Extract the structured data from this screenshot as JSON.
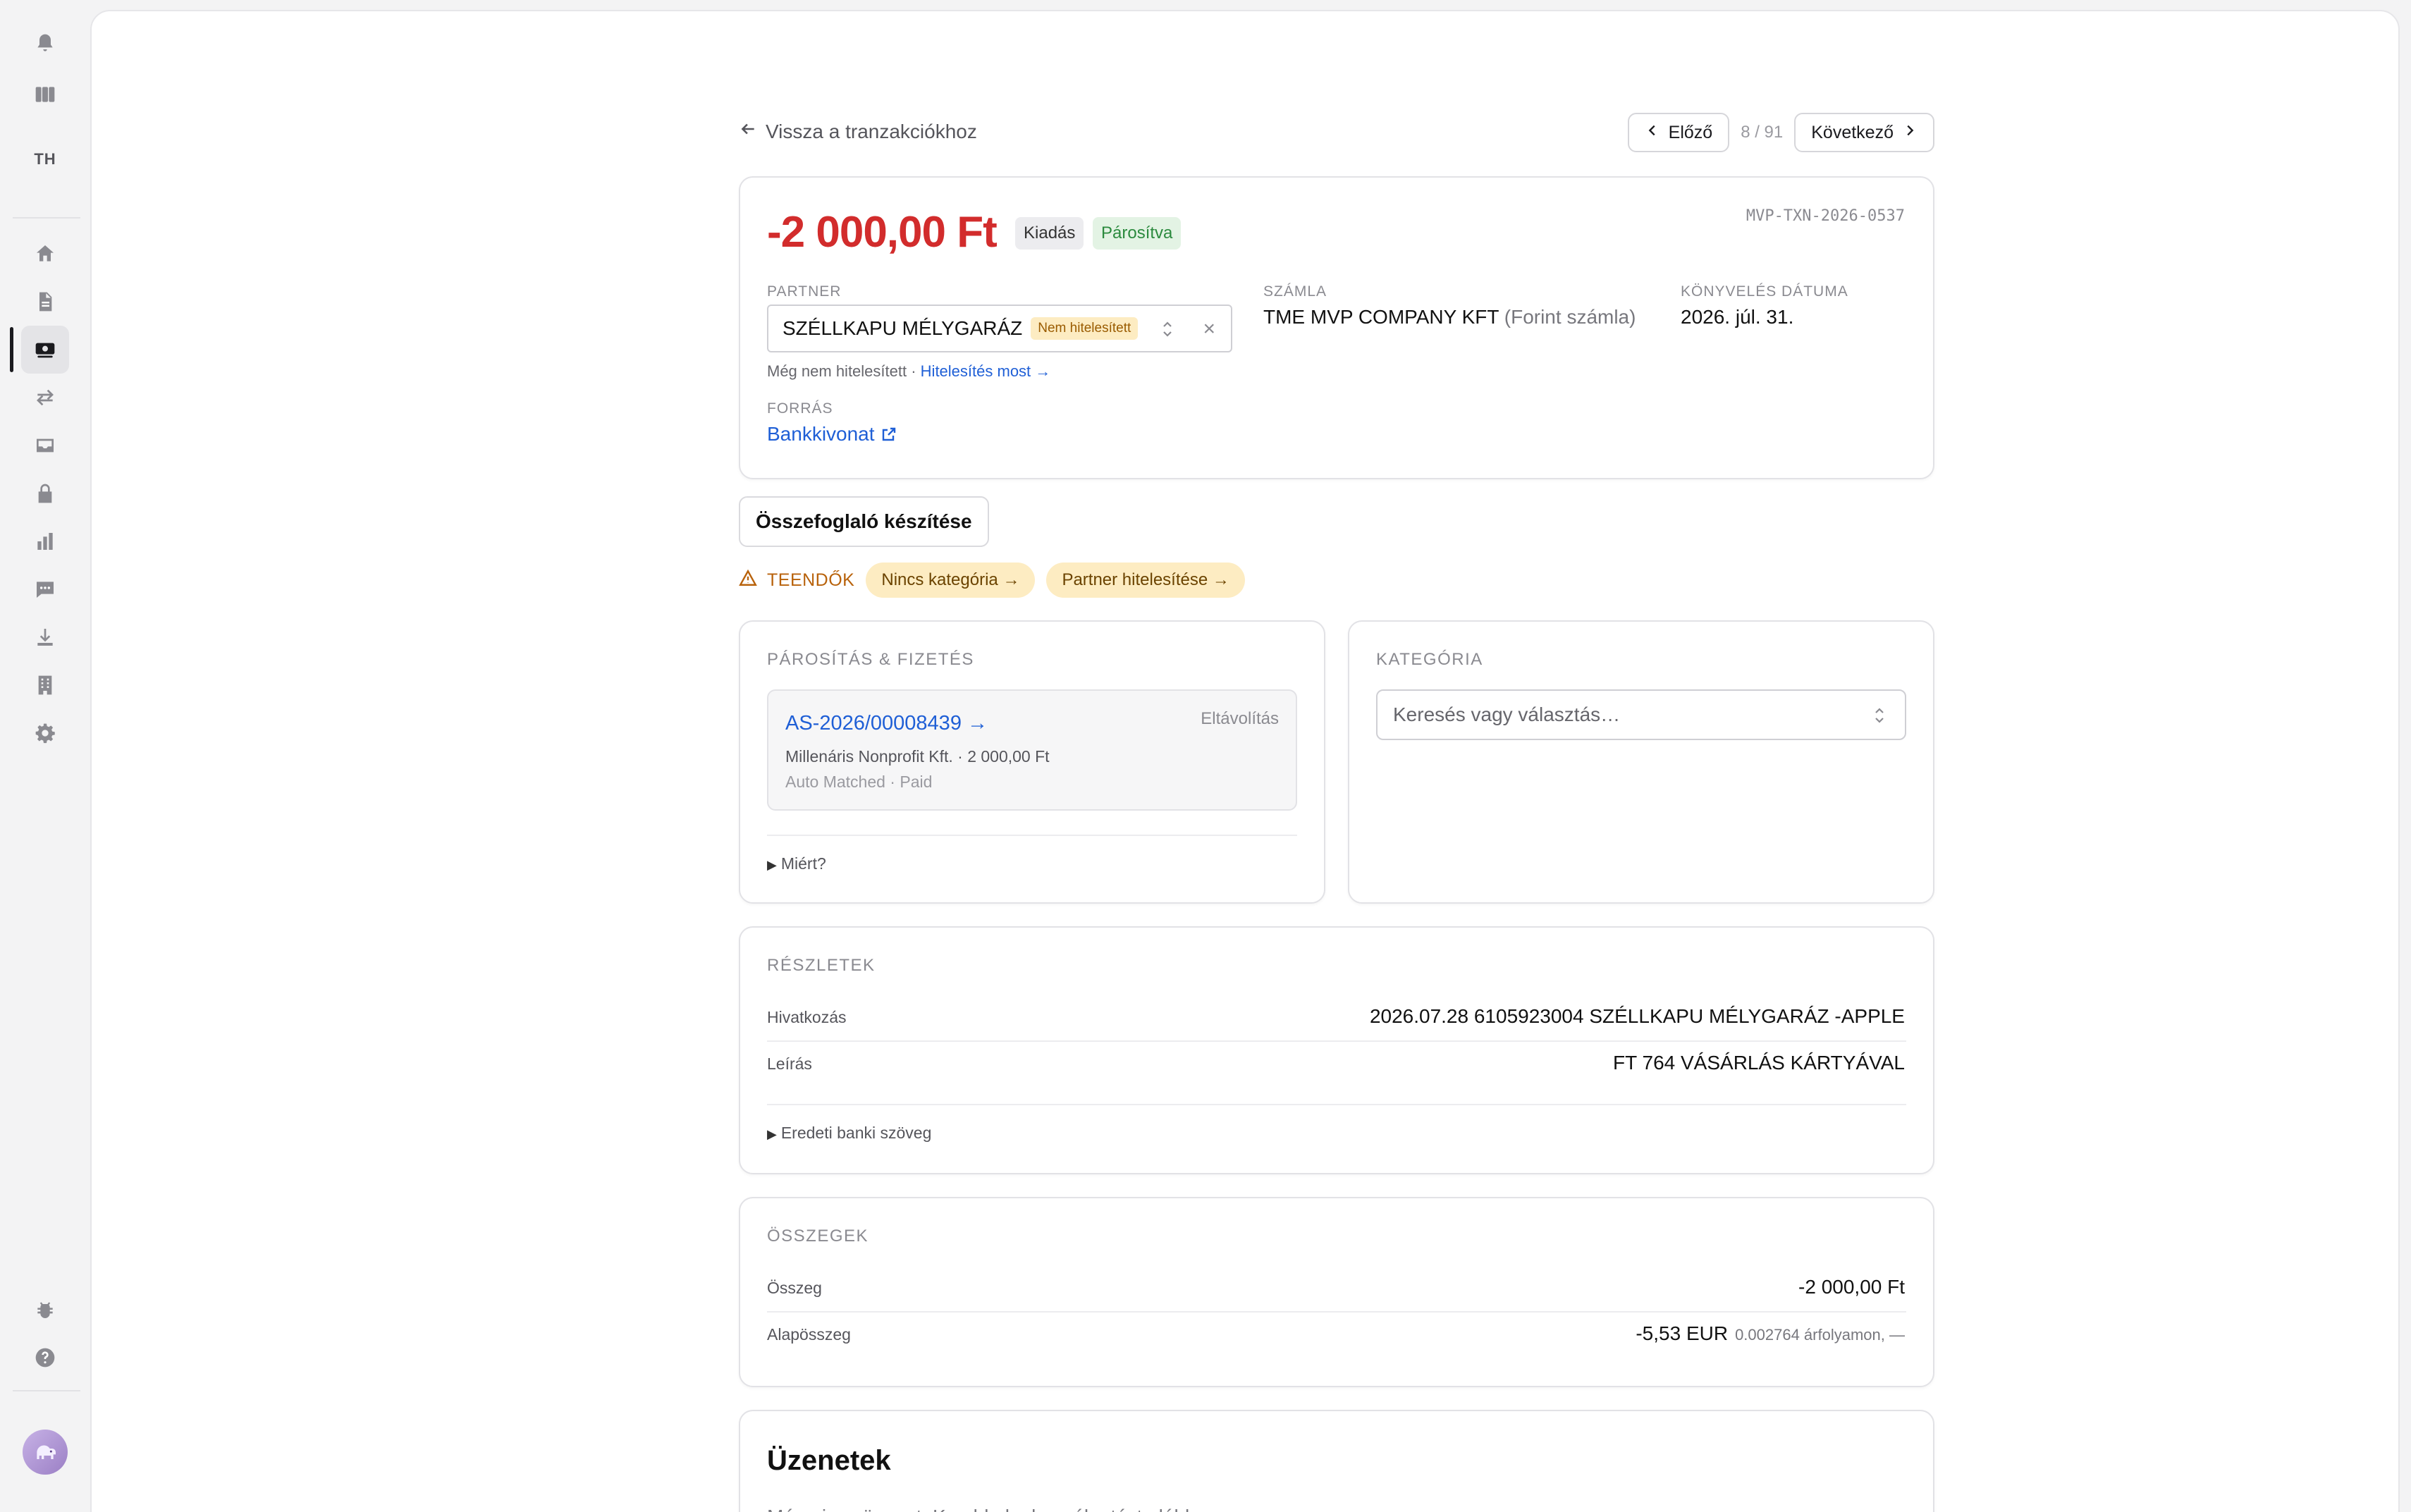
{
  "sidebar": {
    "initials": "TH",
    "top_icons": [
      "bell-icon",
      "columns-icon"
    ],
    "nav_icons": [
      "home-icon",
      "document-icon",
      "cash-icon",
      "transfer-icon",
      "inbox-icon",
      "lock-icon",
      "bar-chart-icon",
      "chat-icon",
      "download-icon",
      "building-icon",
      "gear-icon"
    ],
    "active_item": "cash-icon",
    "bottom_icons": [
      "bug-icon",
      "help-icon"
    ],
    "avatar": "elephant-avatar"
  },
  "nav": {
    "back_label": "Vissza a tranzakciókhoz",
    "prev_label": "Előző",
    "position": "8 / 91",
    "next_label": "Következő"
  },
  "transaction": {
    "amount": "-2 000,00 Ft",
    "type_badge": "Kiadás",
    "status_badge": "Párosítva",
    "id": "MVP-TXN-2026-0537",
    "partner_label": "PARTNER",
    "partner_name": "SZÉLLKAPU MÉLYGARÁZ",
    "partner_badge": "Nem hitelesített",
    "partner_note": "Még nem hitelesített ·",
    "partner_verify_link": "Hitelesítés most →",
    "account_label": "SZÁMLA",
    "account_name": "TME MVP COMPANY KFT",
    "account_sub": "(Forint számla)",
    "booking_label": "KÖNYVELÉS DÁTUMA",
    "booking_date": "2026. júl. 31.",
    "source_label": "FORRÁS",
    "source_link": "Bankkivonat"
  },
  "actions": {
    "summary_button": "Összefoglaló készítése"
  },
  "todos": {
    "label": "TEENDŐK",
    "items": [
      "Nincs kategória →",
      "Partner hitelesítése →"
    ]
  },
  "matching": {
    "title": "PÁROSÍTÁS & FIZETÉS",
    "invoice_link": "AS-2026/00008439 →",
    "remove_label": "Eltávolítás",
    "invoice_sub": "Millenáris Nonprofit Kft. · 2 000,00 Ft",
    "invoice_status": "Auto Matched · Paid",
    "why_label": "Miért?"
  },
  "category": {
    "title": "KATEGÓRIA",
    "placeholder": "Keresés vagy választás…"
  },
  "details": {
    "title": "RÉSZLETEK",
    "rows": [
      {
        "label": "Hivatkozás",
        "value": "2026.07.28 6105923004 SZÉLLKAPU MÉLYGARÁZ -APPLE"
      },
      {
        "label": "Leírás",
        "value": "FT 764 VÁSÁRLÁS KÁRTYÁVAL"
      }
    ],
    "raw_text_label": "Eredeti banki szöveg"
  },
  "sums": {
    "title": "ÖSSZEGEK",
    "amount_label": "Összeg",
    "amount_value": "-2 000,00 Ft",
    "base_label": "Alapösszeg",
    "base_value": "-5,53 EUR",
    "base_rate": "0.002764 árfolyamon, —"
  },
  "messages": {
    "title": "Üzenetek",
    "empty_text": "Még nincs üzenet. Kezdd el a beszélgetést alább."
  },
  "colors": {
    "negative_amount": "#d22c2c",
    "link": "#1f5fd6",
    "todo": "#b8620b",
    "pill_bg": "#fdecc2",
    "matched_badge_bg": "#e3f3e4"
  }
}
